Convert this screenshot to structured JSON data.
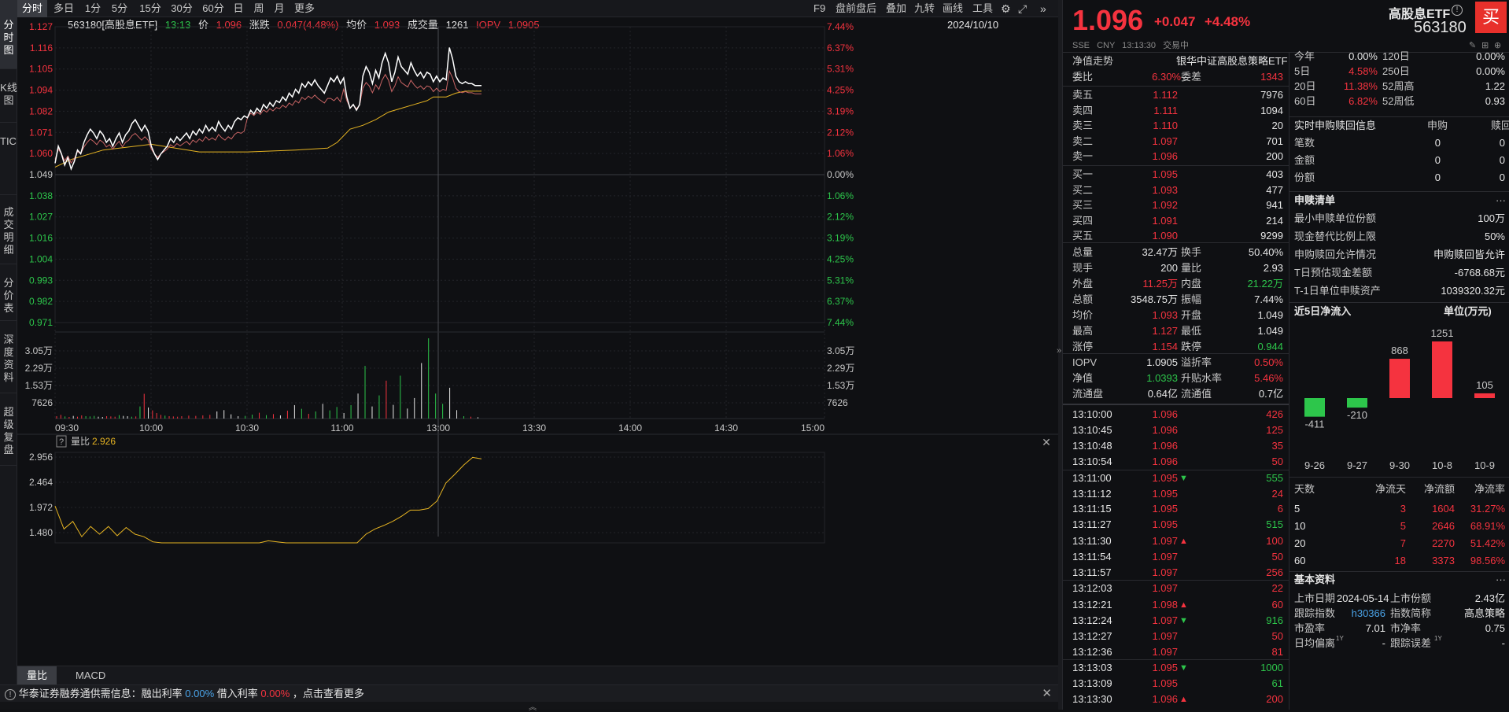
{
  "sidebar": {
    "tabs": [
      {
        "label": "分时图",
        "active": true
      },
      {
        "label": "K线图",
        "active": false
      },
      {
        "label": "TICK",
        "active": false
      },
      {
        "label": "成交明细",
        "active": false
      },
      {
        "label": "分价表",
        "active": false
      },
      {
        "label": "深度资料",
        "active": false
      },
      {
        "label": "超级复盘",
        "active": false
      }
    ]
  },
  "periods": [
    "分时",
    "多日",
    "1分",
    "5分",
    "15分",
    "30分",
    "60分",
    "日",
    "周",
    "月",
    "更多"
  ],
  "toolbar": {
    "f9": "F9",
    "premarket": "盘前盘后",
    "overlay": "叠加",
    "ninegrid": "九转",
    "draw": "画线",
    "tools": "工具"
  },
  "info": {
    "code_name": "563180[高股息ETF]",
    "time": "13:13",
    "price_label": "价",
    "price": "1.096",
    "change_label": "涨跌",
    "change": "0.047(4.48%)",
    "avg_label": "均价",
    "avg": "1.093",
    "vol_label": "成交量",
    "vol": "1261",
    "iopv_label": "IOPV",
    "iopv": "1.0905",
    "date": "2024/10/10"
  },
  "price_axis": {
    "left": [
      "1.127",
      "1.116",
      "1.105",
      "1.094",
      "1.082",
      "1.071",
      "1.060",
      "1.049",
      "1.038",
      "1.027",
      "1.016",
      "1.004",
      "0.993",
      "0.982",
      "0.971"
    ],
    "right": [
      "7.44%",
      "6.37%",
      "5.31%",
      "4.25%",
      "3.19%",
      "2.12%",
      "1.06%",
      "0.00%",
      "1.06%",
      "2.12%",
      "3.19%",
      "4.25%",
      "5.31%",
      "6.37%",
      "7.44%"
    ]
  },
  "volume_axis": [
    "3.05万",
    "2.29万",
    "1.53万",
    "7626"
  ],
  "time_axis": [
    "09:30",
    "10:00",
    "10:30",
    "11:00",
    "13:00",
    "13:30",
    "14:00",
    "14:30",
    "15:00"
  ],
  "chart_data": {
    "type": "line",
    "title": "563180[高股息ETF]",
    "ylim": [
      0.971,
      1.127
    ],
    "prev_close": 1.049,
    "x": [
      "09:30",
      "09:45",
      "10:00",
      "10:15",
      "10:30",
      "10:45",
      "11:00",
      "11:10",
      "11:20",
      "13:00",
      "13:05",
      "13:13"
    ],
    "series": [
      {
        "name": "价",
        "color": "#ffffff",
        "values": [
          1.052,
          1.07,
          1.06,
          1.073,
          1.063,
          1.072,
          1.075,
          1.101,
          1.11,
          1.103,
          1.118,
          1.096
        ]
      },
      {
        "name": "均价",
        "color": "#e6b422",
        "values": [
          1.053,
          1.061,
          1.065,
          1.06,
          1.061,
          1.062,
          1.065,
          1.078,
          1.085,
          1.09,
          1.093,
          1.093
        ]
      },
      {
        "name": "IOPV",
        "color": "#c86464",
        "values": [
          1.051,
          1.064,
          1.06,
          1.066,
          1.065,
          1.07,
          1.074,
          1.088,
          1.092,
          1.094,
          1.095,
          1.0905
        ]
      }
    ],
    "volume": {
      "max": 30500,
      "values": [
        900,
        1400,
        800,
        600,
        1000,
        700,
        1200,
        900,
        800,
        1000,
        700,
        600,
        900,
        800,
        700,
        1300,
        1000,
        900,
        700,
        800,
        4600,
        9400,
        4200,
        3100,
        2100,
        1400,
        1100,
        900,
        800,
        700,
        900,
        1100,
        1000,
        1200,
        1400,
        2700,
        3200,
        1600,
        900,
        1000,
        1500,
        2200,
        1300,
        1700,
        1200,
        3000,
        5100,
        3700,
        1800,
        2700,
        5600,
        3100,
        4400,
        2100,
        5100,
        9500,
        20000,
        4600,
        8800,
        14400,
        5200,
        16300,
        3800,
        7800,
        21100,
        30500,
        9500,
        5600,
        11700,
        3200,
        900,
        700,
        500
      ],
      "colors": "mixed red/green/white by tick direction"
    }
  },
  "volume_ratio": {
    "label": "量比",
    "value": "2.926",
    "axis": [
      "2.956",
      "2.464",
      "1.972",
      "1.480"
    ],
    "values": [
      2.0,
      1.55,
      1.7,
      1.4,
      1.6,
      1.45,
      1.6,
      1.42,
      1.58,
      1.45,
      1.4,
      1.3,
      1.22,
      1.2,
      1.18,
      1.2,
      1.18,
      1.17,
      1.18,
      1.19,
      1.2,
      1.22,
      1.25,
      1.28,
      1.32,
      1.3,
      1.28,
      1.25,
      1.22,
      1.2,
      1.18,
      1.16,
      1.15,
      1.14,
      1.2,
      1.45,
      1.55,
      1.62,
      1.7,
      1.8,
      1.92,
      1.92,
      1.95,
      2.1,
      2.45,
      2.62,
      2.8,
      2.95,
      2.92
    ]
  },
  "bottom_tabs": [
    "量比",
    "MACD"
  ],
  "notice": {
    "source": "华泰证券融券通供需信息：融出利率",
    "rate1": "0.00%",
    "mid": "借入利率",
    "rate2": "0.00%",
    "tail": "，点击查看更多"
  },
  "quote": {
    "price": "1.096",
    "change": "+0.047",
    "pct": "+4.48%",
    "name": "高股息ETF",
    "code": "563180",
    "buy_button": "买",
    "exchange": "SSE",
    "currency": "CNY",
    "time": "13:13:30",
    "status": "交易中"
  },
  "orderbook": {
    "nav_label": "净值走势",
    "fund_name": "银华中证高股息策略ETF",
    "wei_bi_label": "委比",
    "wei_bi": "6.30%",
    "wei_cha_label": "委差",
    "wei_cha": "1343",
    "asks": [
      {
        "label": "卖五",
        "price": "1.112",
        "vol": "7976"
      },
      {
        "label": "卖四",
        "price": "1.111",
        "vol": "1094"
      },
      {
        "label": "卖三",
        "price": "1.110",
        "vol": "20"
      },
      {
        "label": "卖二",
        "price": "1.097",
        "vol": "701"
      },
      {
        "label": "卖一",
        "price": "1.096",
        "vol": "200"
      }
    ],
    "bids": [
      {
        "label": "买一",
        "price": "1.095",
        "vol": "403"
      },
      {
        "label": "买二",
        "price": "1.093",
        "vol": "477"
      },
      {
        "label": "买三",
        "price": "1.092",
        "vol": "941"
      },
      {
        "label": "买四",
        "price": "1.091",
        "vol": "214"
      },
      {
        "label": "买五",
        "price": "1.090",
        "vol": "9299"
      }
    ]
  },
  "stats": [
    {
      "l1": "总量",
      "v1": "32.47万",
      "c1": "white",
      "l2": "换手",
      "v2": "50.40%",
      "c2": "white"
    },
    {
      "l1": "现手",
      "v1": "200",
      "c1": "white",
      "l2": "量比",
      "v2": "2.93",
      "c2": "white"
    },
    {
      "l1": "外盘",
      "v1": "11.25万",
      "c1": "red",
      "l2": "内盘",
      "v2": "21.22万",
      "c2": "green"
    },
    {
      "l1": "总额",
      "v1": "3548.75万",
      "c1": "white",
      "l2": "振幅",
      "v2": "7.44%",
      "c2": "white"
    },
    {
      "l1": "均价",
      "v1": "1.093",
      "c1": "red",
      "l2": "开盘",
      "v2": "1.049",
      "c2": "white"
    },
    {
      "l1": "最高",
      "v1": "1.127",
      "c1": "red",
      "l2": "最低",
      "v2": "1.049",
      "c2": "white"
    },
    {
      "l1": "涨停",
      "v1": "1.154",
      "c1": "red",
      "l2": "跌停",
      "v2": "0.944",
      "c2": "green"
    }
  ],
  "fund_stats": [
    {
      "l1": "IOPV",
      "v1": "1.0905",
      "c1": "white",
      "l2": "溢折率",
      "v2": "0.50%",
      "c2": "red"
    },
    {
      "l1": "净值",
      "v1": "1.0393",
      "c1": "green",
      "l2": "升贴水率",
      "v2": "5.46%",
      "c2": "red"
    },
    {
      "l1": "流通盘",
      "v1": "0.64亿",
      "c1": "white",
      "l2": "流通值",
      "v2": "0.7亿",
      "c2": "white"
    }
  ],
  "ticks": [
    {
      "t": "13:10:00",
      "p": "1.096",
      "pc": "red",
      "arrow": "",
      "v": "426",
      "vc": "red"
    },
    {
      "t": "13:10:45",
      "p": "1.096",
      "pc": "red",
      "arrow": "",
      "v": "125",
      "vc": "red"
    },
    {
      "t": "13:10:48",
      "p": "1.096",
      "pc": "red",
      "arrow": "",
      "v": "35",
      "vc": "red"
    },
    {
      "t": "13:10:54",
      "p": "1.096",
      "pc": "red",
      "arrow": "",
      "v": "50",
      "vc": "red"
    },
    {
      "t": "13:11:00",
      "p": "1.095",
      "pc": "red",
      "arrow": "down",
      "v": "555",
      "vc": "green"
    },
    {
      "t": "13:11:12",
      "p": "1.095",
      "pc": "red",
      "arrow": "",
      "v": "24",
      "vc": "red"
    },
    {
      "t": "13:11:15",
      "p": "1.095",
      "pc": "red",
      "arrow": "",
      "v": "6",
      "vc": "red"
    },
    {
      "t": "13:11:27",
      "p": "1.095",
      "pc": "red",
      "arrow": "",
      "v": "515",
      "vc": "green"
    },
    {
      "t": "13:11:30",
      "p": "1.097",
      "pc": "red",
      "arrow": "up",
      "v": "100",
      "vc": "red"
    },
    {
      "t": "13:11:54",
      "p": "1.097",
      "pc": "red",
      "arrow": "",
      "v": "50",
      "vc": "red"
    },
    {
      "t": "13:11:57",
      "p": "1.097",
      "pc": "red",
      "arrow": "",
      "v": "256",
      "vc": "red"
    },
    {
      "t": "13:12:03",
      "p": "1.097",
      "pc": "red",
      "arrow": "",
      "v": "22",
      "vc": "red"
    },
    {
      "t": "13:12:21",
      "p": "1.098",
      "pc": "red",
      "arrow": "up",
      "v": "60",
      "vc": "red"
    },
    {
      "t": "13:12:24",
      "p": "1.097",
      "pc": "red",
      "arrow": "down",
      "v": "916",
      "vc": "green"
    },
    {
      "t": "13:12:27",
      "p": "1.097",
      "pc": "red",
      "arrow": "",
      "v": "50",
      "vc": "red"
    },
    {
      "t": "13:12:36",
      "p": "1.097",
      "pc": "red",
      "arrow": "",
      "v": "81",
      "vc": "red"
    },
    {
      "t": "13:13:03",
      "p": "1.095",
      "pc": "red",
      "arrow": "down",
      "v": "1000",
      "vc": "green"
    },
    {
      "t": "13:13:09",
      "p": "1.095",
      "pc": "red",
      "arrow": "",
      "v": "61",
      "vc": "green"
    },
    {
      "t": "13:13:30",
      "p": "1.096",
      "pc": "red",
      "arrow": "up",
      "v": "200",
      "vc": "red"
    }
  ],
  "returns": [
    {
      "l1": "今年",
      "v1": "0.00%",
      "c1": "white",
      "l2": "120日",
      "v2": "0.00%",
      "c2": "white"
    },
    {
      "l1": "5日",
      "v1": "4.58%",
      "c1": "red",
      "l2": "250日",
      "v2": "0.00%",
      "c2": "white"
    },
    {
      "l1": "20日",
      "v1": "11.38%",
      "c1": "red",
      "l2": "52周高",
      "v2": "1.22",
      "c2": "white"
    },
    {
      "l1": "60日",
      "v1": "6.82%",
      "c1": "red",
      "l2": "52周低",
      "v2": "0.93",
      "c2": "white"
    }
  ],
  "redemption": {
    "title": "实时申购赎回信息",
    "col1": "申购",
    "col2": "赎回",
    "rows": [
      {
        "label": "笔数",
        "a": "0",
        "b": "0"
      },
      {
        "label": "金额",
        "a": "0",
        "b": "0"
      },
      {
        "label": "份额",
        "a": "0",
        "b": "0"
      }
    ]
  },
  "creation": {
    "title": "申赎清单",
    "more": "···",
    "rows": [
      {
        "label": "最小申赎单位份额",
        "value": "100万"
      },
      {
        "label": "现金替代比例上限",
        "value": "50%"
      },
      {
        "label": "申购赎回允许情况",
        "value": "申购赎回皆允许"
      },
      {
        "label": "T日预估现金差额",
        "value": "-6768.68元"
      },
      {
        "label": "T-1日单位申赎资产",
        "value": "1039320.32元"
      }
    ]
  },
  "netflow": {
    "title": "近5日净流入",
    "unit": "单位(万元)",
    "chart_data": {
      "type": "bar",
      "categories": [
        "9-26",
        "9-27",
        "9-30",
        "10-8",
        "10-9"
      ],
      "values": [
        -411,
        -210,
        868,
        1251,
        105
      ],
      "title": "近5日净流入",
      "ylabel": "单位(万元)"
    }
  },
  "netflow_table": {
    "headers": [
      "天数",
      "净流天",
      "净流额",
      "净流率"
    ],
    "rows": [
      [
        "5",
        "3",
        "1604",
        "31.27%"
      ],
      [
        "10",
        "5",
        "2646",
        "68.91%"
      ],
      [
        "20",
        "7",
        "2270",
        "51.42%"
      ],
      [
        "60",
        "18",
        "3373",
        "98.56%"
      ]
    ]
  },
  "basics": {
    "title": "基本资料",
    "more": "···",
    "rows": [
      {
        "l1": "上市日期",
        "v1": "2024-05-14",
        "c1": "white",
        "l2": "上市份额",
        "v2": "2.43亿",
        "c2": "white"
      },
      {
        "l1": "跟踪指数",
        "v1": "h30366",
        "c1": "blue",
        "l2": "指数简称",
        "v2": "高息策略",
        "c2": "white"
      },
      {
        "l1": "市盈率",
        "v1": "7.01",
        "c1": "white",
        "l2": "市净率",
        "v2": "0.75",
        "c2": "white"
      },
      {
        "l1": "日均偏离",
        "v1": "-",
        "c1": "white",
        "l2": "跟踪误差",
        "v2": "-",
        "c2": "white"
      }
    ],
    "superscript": "1Y"
  },
  "colors": {
    "up": "#f5333f",
    "down": "#2dc64b",
    "price_line": "#ffffff",
    "avg_line": "#e6b422",
    "iopv_line": "#c86464",
    "accent": "#e6b422"
  }
}
